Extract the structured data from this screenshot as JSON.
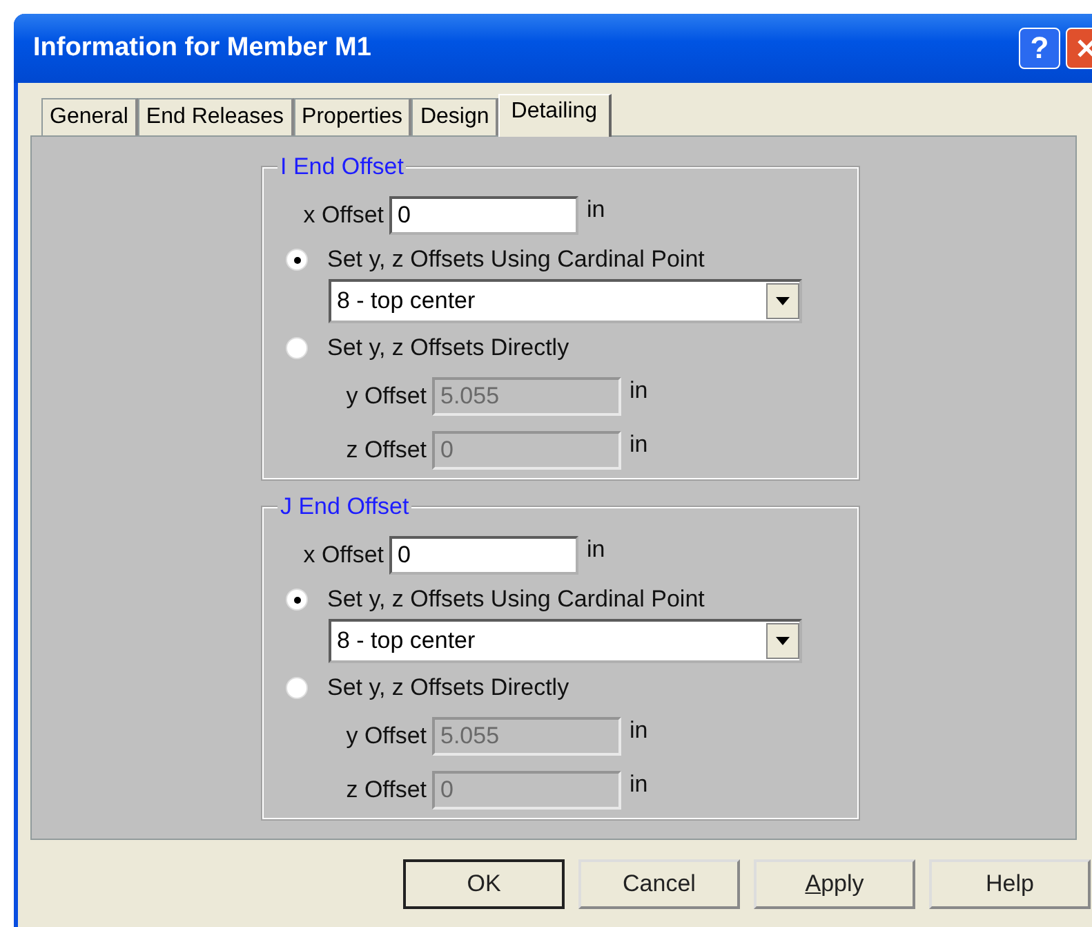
{
  "window": {
    "title": "Information for Member M1",
    "help_button": "?"
  },
  "tabs": [
    {
      "label": "General",
      "selected": false
    },
    {
      "label": "End Releases",
      "selected": false
    },
    {
      "label": "Properties",
      "selected": false
    },
    {
      "label": "Design",
      "selected": false
    },
    {
      "label": "Detailing",
      "selected": true
    }
  ],
  "groups": [
    {
      "title": "I End Offset",
      "x_offset": {
        "label": "x Offset",
        "value": "0",
        "unit": "in"
      },
      "options": [
        {
          "label": "Set y, z Offsets Using Cardinal Point",
          "selected": true
        },
        {
          "label": "Set y, z Offsets Directly",
          "selected": false
        }
      ],
      "cardinal_point": "8 - top center",
      "y_offset": {
        "label": "y Offset",
        "value": "5.055",
        "unit": "in",
        "disabled": true
      },
      "z_offset": {
        "label": "z Offset",
        "value": "0",
        "unit": "in",
        "disabled": true
      }
    },
    {
      "title": "J End Offset",
      "x_offset": {
        "label": "x Offset",
        "value": "0",
        "unit": "in"
      },
      "options": [
        {
          "label": "Set y, z Offsets Using Cardinal Point",
          "selected": true
        },
        {
          "label": "Set y, z Offsets Directly",
          "selected": false
        }
      ],
      "cardinal_point": "8 - top center",
      "y_offset": {
        "label": "y Offset",
        "value": "5.055",
        "unit": "in",
        "disabled": true
      },
      "z_offset": {
        "label": "z Offset",
        "value": "0",
        "unit": "in",
        "disabled": true
      }
    }
  ],
  "buttons": [
    {
      "label": "OK",
      "default": true,
      "mnemonic": false
    },
    {
      "label": "Cancel",
      "default": false,
      "mnemonic": false
    },
    {
      "label": "Apply",
      "default": false,
      "mnemonic": true
    },
    {
      "label": "Help",
      "default": false,
      "mnemonic": false
    }
  ]
}
